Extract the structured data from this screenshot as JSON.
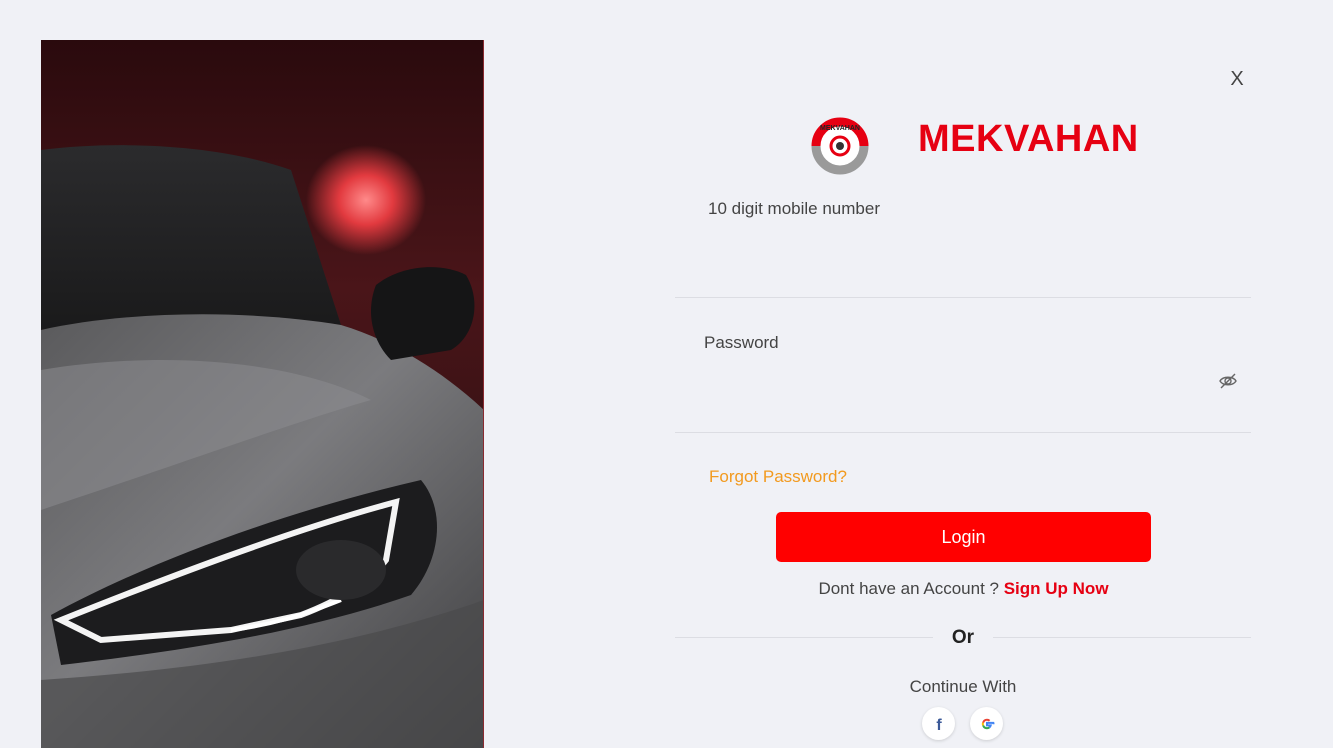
{
  "brand": {
    "name": "MEKVAHAN",
    "logo_icon": "mekvahan-logo-icon",
    "logo_text": "MEKVAHAN"
  },
  "close": {
    "label": "X"
  },
  "mobile": {
    "label": "10 digit mobile number",
    "value": ""
  },
  "password": {
    "label": "Password",
    "value": "",
    "toggle_icon": "eye-slash-icon"
  },
  "forgot_label": "Forgot Password?",
  "login_label": "Login",
  "signup": {
    "prompt": "Dont have an Account ?",
    "link": "Sign Up Now"
  },
  "divider_label": "Or",
  "continue_label": "Continue With",
  "social": [
    {
      "icon": "facebook-icon"
    },
    {
      "icon": "google-icon"
    }
  ],
  "colors": {
    "brand_red": "#e60012",
    "button_red": "#ff0000",
    "forgot_orange": "#f29a1f",
    "background": "#f0f1f6"
  }
}
